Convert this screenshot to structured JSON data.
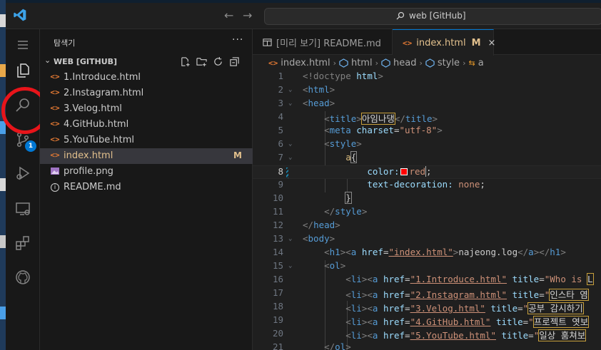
{
  "titlebar": {
    "command_center": "web [GitHub]"
  },
  "activity": {
    "badge": "1"
  },
  "sidebar": {
    "title": "탐색기",
    "more": "···",
    "folder": "WEB [GITHUB]",
    "files": [
      {
        "label": "1.Introduce.html",
        "type": "html",
        "status": ""
      },
      {
        "label": "2.Instagram.html",
        "type": "html",
        "status": ""
      },
      {
        "label": "3.Velog.html",
        "type": "html",
        "status": ""
      },
      {
        "label": "4.GitHub.html",
        "type": "html",
        "status": ""
      },
      {
        "label": "5.YouTube.html",
        "type": "html",
        "status": ""
      },
      {
        "label": "index.html",
        "type": "html",
        "status": "M"
      },
      {
        "label": "profile.png",
        "type": "image",
        "status": ""
      },
      {
        "label": "README.md",
        "type": "info",
        "status": ""
      }
    ]
  },
  "editor": {
    "tabs": [
      {
        "label": "[미리 보기] README.md",
        "modified": ""
      },
      {
        "label": "index.html",
        "modified": "M",
        "close": "×"
      }
    ],
    "breadcrumbs": [
      "index.html",
      "html",
      "head",
      "style",
      "a"
    ],
    "line_numbers": [
      "1",
      "2",
      "3",
      "4",
      "5",
      "6",
      "7",
      "8",
      "9",
      "10",
      "11",
      "12",
      "13",
      "14",
      "15",
      "16",
      "17",
      "18",
      "19",
      "20",
      "21"
    ],
    "code": {
      "l1_doctype": "<!doctype",
      "l1_html": "html",
      "l1_close": ">",
      "title_text": "아임나댕",
      "charset": "\"utf-8\"",
      "color_prop": "color:",
      "color_val": "red",
      "td_prop": "text-decoration:",
      "td_val": "none",
      "h1_href": "\"index.html\"",
      "h1_text": "najeong.log",
      "li": [
        {
          "href": "\"1.Introduce.html\"",
          "title": "\"Who is ",
          "title_hl": "L"
        },
        {
          "href": "\"2.Instagram.html\"",
          "title": "\"",
          "title_hl": "인스타 염"
        },
        {
          "href": "\"3.Velog.html\"",
          "title": "\"",
          "title_hl": "공부 감시하기"
        },
        {
          "href": "\"4.GitHub.html\"",
          "title": "\"",
          "title_hl": "프로젝트 엿보"
        },
        {
          "href": "\"5.YouTube.html\"",
          "title": "\"",
          "title_hl": "일상 훔쳐보"
        }
      ]
    }
  },
  "colors": {
    "accent": "#0078d4",
    "modified": "#e2c08d",
    "annotation_circle": "#e8141a"
  }
}
